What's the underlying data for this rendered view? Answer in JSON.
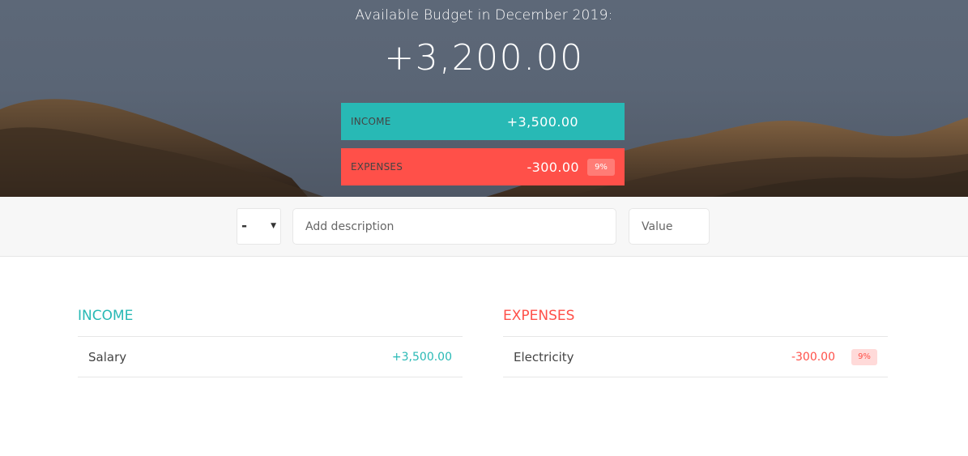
{
  "header": {
    "title": "Available Budget in December 2019:",
    "budget": "+3,200.00",
    "income": {
      "label": "Income",
      "value": "+3,500.00"
    },
    "expenses": {
      "label": "Expenses",
      "value": "-300.00",
      "percentage": "9%"
    }
  },
  "add_form": {
    "type_value": "-",
    "description_placeholder": "Add description",
    "value_placeholder": "Value"
  },
  "income_list": {
    "title": "Income",
    "items": [
      {
        "description": "Salary",
        "value": "+3,500.00"
      }
    ]
  },
  "expenses_list": {
    "title": "Expenses",
    "items": [
      {
        "description": "Electricity",
        "value": "-300.00",
        "percentage": "9%"
      }
    ]
  },
  "colors": {
    "income": "#28b9b5",
    "expenses": "#ff5049",
    "hero_sky": "#5a6575",
    "hills": "#5c4632"
  },
  "icons": {
    "select_caret": "caret-down-icon"
  }
}
